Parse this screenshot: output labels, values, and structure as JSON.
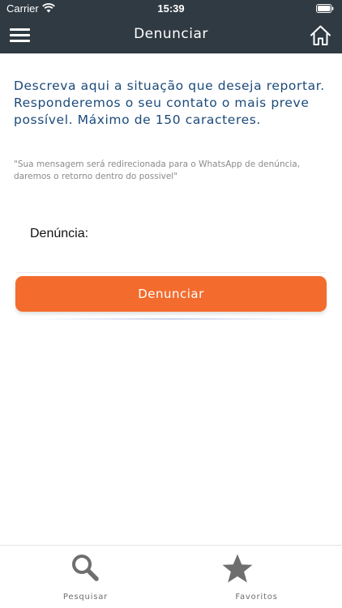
{
  "status_bar": {
    "carrier": "Carrier",
    "time": "15:39"
  },
  "header": {
    "title": "Denunciar",
    "menu_icon": "hamburger-menu-icon",
    "home_icon": "home-icon"
  },
  "content": {
    "description": "Descreva aqui a situação que deseja reportar. Responderemos o seu contato o mais preve possível. Máximo de 150 caracteres.",
    "note": "\"Sua mensagem será redirecionada para o WhatsApp de denúncia, daremos o retorno dentro do possivel\"",
    "field_label": "Denúncia:",
    "field_value": "",
    "button_label": "Denunciar"
  },
  "tabs": [
    {
      "label": "Pesquisar",
      "icon": "search-icon"
    },
    {
      "label": "Favoritos",
      "icon": "star-icon"
    }
  ],
  "colors": {
    "header_bg": "#2f3a43",
    "accent": "#f36c2e",
    "description_text": "#1b4a7a",
    "note_text": "#8a8a8a",
    "tab_icon": "#6e6e6e"
  }
}
